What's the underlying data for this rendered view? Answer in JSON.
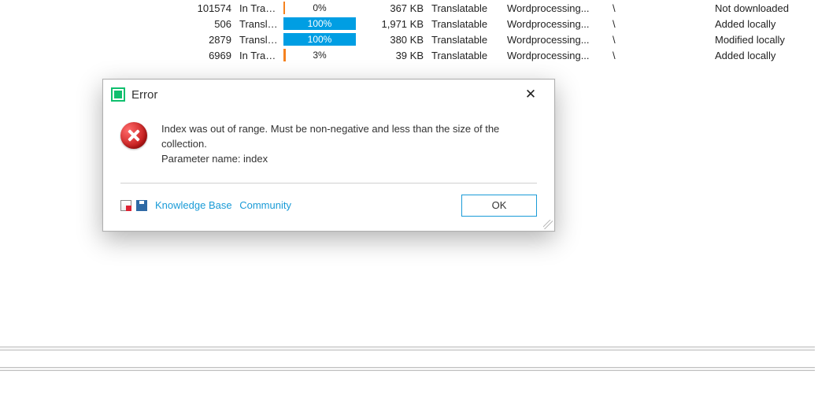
{
  "rows": [
    {
      "id": "101574",
      "status": "In Transl...",
      "pct": 0,
      "pct_label": "0%",
      "size": "367 KB",
      "type": "Translatable",
      "format": "Wordprocessing...",
      "path": "\\",
      "dl": "Not downloaded"
    },
    {
      "id": "506",
      "status": "Translati...",
      "pct": 100,
      "pct_label": "100%",
      "size": "1,971 KB",
      "type": "Translatable",
      "format": "Wordprocessing...",
      "path": "\\",
      "dl": "Added locally"
    },
    {
      "id": "2879",
      "status": "Translati...",
      "pct": 100,
      "pct_label": "100%",
      "size": "380 KB",
      "type": "Translatable",
      "format": "Wordprocessing...",
      "path": "\\",
      "dl": "Modified locally"
    },
    {
      "id": "6969",
      "status": "In Transl...",
      "pct": 3,
      "pct_label": "3%",
      "size": "39 KB",
      "type": "Translatable",
      "format": "Wordprocessing...",
      "path": "\\",
      "dl": "Added locally"
    }
  ],
  "dialog": {
    "title": "Error",
    "message_line1": "Index was out of range. Must be non-negative and less than the size of the collection.",
    "message_line2": "Parameter name: index",
    "link_kb": "Knowledge Base",
    "link_community": "Community",
    "ok": "OK"
  }
}
